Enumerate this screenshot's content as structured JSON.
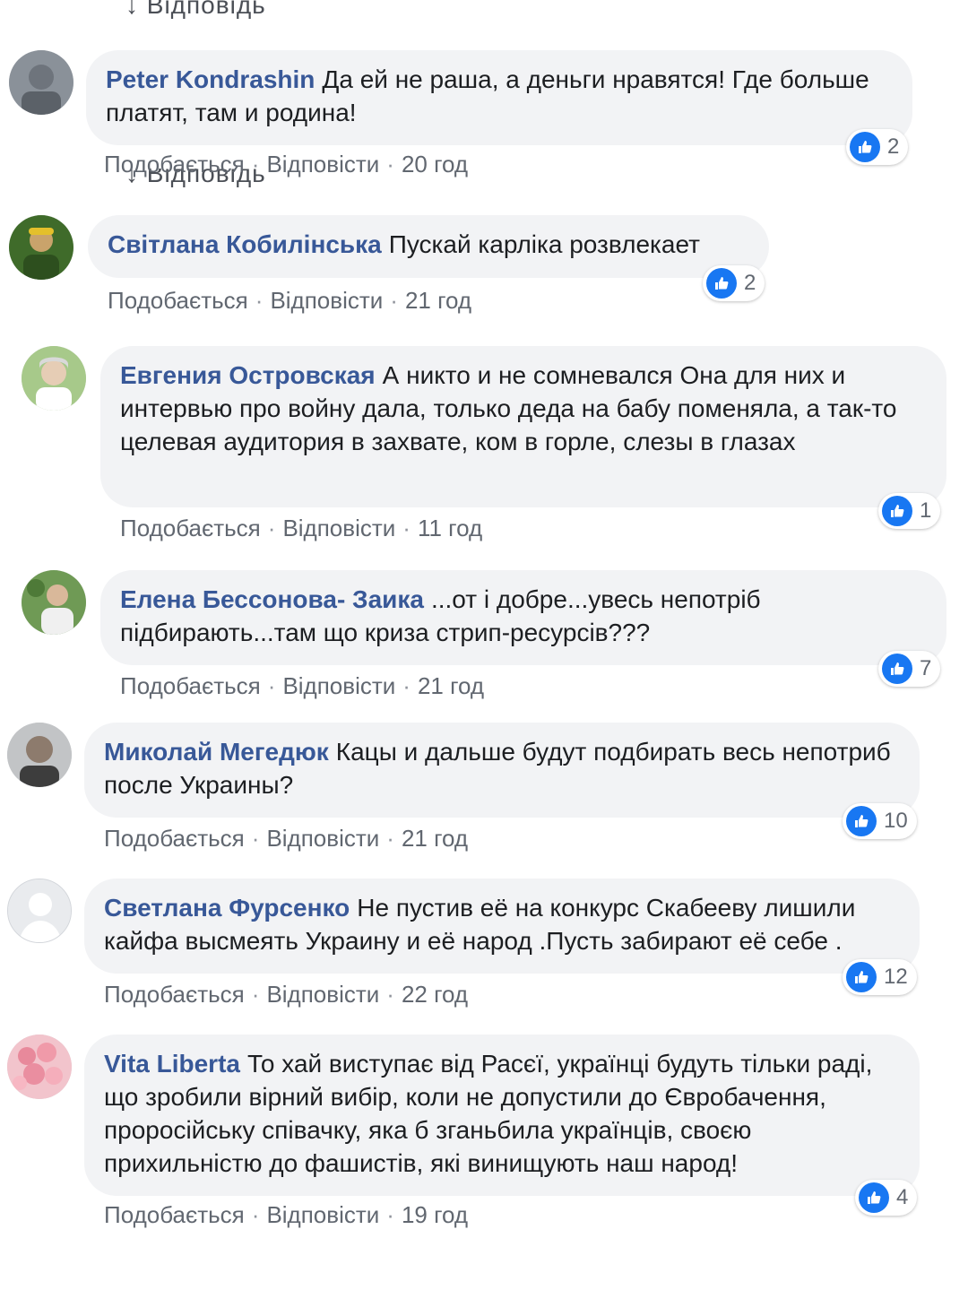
{
  "reply_stub_top": "↓ Відповідь",
  "reply_stub_mid": "↓ Відповідь",
  "labels": {
    "like": "Подобається",
    "reply": "Відповісти",
    "separator": "·"
  },
  "colors": {
    "author": "#385898",
    "bubble": "#f2f3f5",
    "like_badge": "#1877f2",
    "meta": "#616770"
  },
  "comments": [
    {
      "author": "Peter Kondrashin",
      "text": "Да ей не раша, а деньги нравятся! Где больше платят, там и родина!",
      "time": "20 год",
      "likes": "2",
      "avatar_icon": "user-photo-avatar"
    },
    {
      "author": "Світлана Кобилінська",
      "text": "Пускай карліка розвлекает",
      "time": "21 год",
      "likes": "2",
      "avatar_icon": "user-photo-avatar"
    },
    {
      "author": "Евгения Островская",
      "text": "А никто и не сомневался Она для них и интервью про войну дала, только деда на бабу поменяла, а так-то целевая аудитория в захвате, ком в горле, слезы в глазах",
      "time": "11 год",
      "likes": "1",
      "avatar_icon": "user-photo-avatar"
    },
    {
      "author": "Елена Бессонова- Заика",
      "text": "...от і добре...увесь непотріб підбирають...там що криза стрип-ресурсів???",
      "time": "21 год",
      "likes": "7",
      "avatar_icon": "user-photo-avatar"
    },
    {
      "author": "Миколай Мегедюк",
      "text": "Кацы и дальше будут подбирать весь непотриб после Украины?",
      "time": "21 год",
      "likes": "10",
      "avatar_icon": "user-photo-avatar"
    },
    {
      "author": "Светлана Фурсенко",
      "text": "Не пустив её на конкурс Скабееву лишили кайфа высмеять Украину и её народ .Пусть забирают её себе .",
      "time": "22 год",
      "likes": "12",
      "avatar_icon": "default-avatar"
    },
    {
      "author": "Vita Liberta",
      "text": "То хай виступає від Расєї, українці будуть тільки раді, що зробили вірний вибір, коли не допустили до Євробачення, проросійську співачку, яка б зганьбила українців, своєю прихильністю до фашистів, які винищують наш народ!",
      "time": "19 год",
      "likes": "4",
      "avatar_icon": "user-photo-avatar"
    }
  ]
}
